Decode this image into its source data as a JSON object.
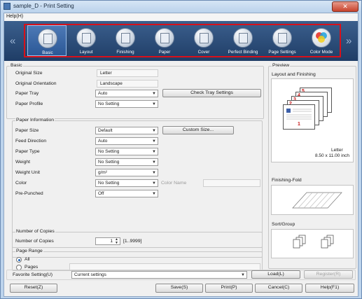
{
  "window": {
    "title": "sample_D - Print Setting"
  },
  "menu": {
    "help": "Help(H)"
  },
  "tabs": [
    {
      "label": "Basic",
      "icon": "basic-icon"
    },
    {
      "label": "Layout",
      "icon": "layout-icon"
    },
    {
      "label": "Finishing",
      "icon": "finishing-icon"
    },
    {
      "label": "Paper",
      "icon": "paper-icon"
    },
    {
      "label": "Cover",
      "icon": "cover-icon"
    },
    {
      "label": "Perfect Binding",
      "icon": "perfect-binding-icon"
    },
    {
      "label": "Page Settings",
      "icon": "page-settings-icon"
    },
    {
      "label": "Color Mode",
      "icon": "color-mode-icon"
    }
  ],
  "basic": {
    "group_title": "Basic",
    "original_size_label": "Original Size",
    "original_size_value": "Letter",
    "original_orientation_label": "Original Orientation",
    "original_orientation_value": "Landscape",
    "paper_tray_label": "Paper Tray",
    "paper_tray_value": "Auto",
    "check_tray_button": "Check Tray Settings",
    "paper_profile_label": "Paper Profile",
    "paper_profile_value": "No Setting"
  },
  "paper_info": {
    "group_title": "Paper Information",
    "paper_size_label": "Paper Size",
    "paper_size_value": "Default",
    "custom_size_button": "Custom Size...",
    "feed_direction_label": "Feed Direction",
    "feed_direction_value": "Auto",
    "paper_type_label": "Paper Type",
    "paper_type_value": "No Setting",
    "weight_label": "Weight",
    "weight_value": "No Setting",
    "weight_unit_label": "Weight Unit",
    "weight_unit_value": "g/m²",
    "color_label": "Color",
    "color_value": "No Setting",
    "color_name_label": "Color Name",
    "pre_punched_label": "Pre-Punched",
    "pre_punched_value": "Off"
  },
  "copies": {
    "group_title": "Number of Copies",
    "label": "Number of Copies",
    "value": "1",
    "range": "[1..9999]"
  },
  "page_range": {
    "group_title": "Page Range",
    "all_label": "All",
    "pages_label": "Pages",
    "selected": "All"
  },
  "preview": {
    "title": "Preview",
    "layout_finishing_label": "Layout and Finishing",
    "paper_size_text": "Letter",
    "paper_dims_text": "8.50 x 11.00 inch",
    "finishing_fold_label": "Finishing-Fold",
    "sort_group_label": "Sort/Group",
    "page_numbers": [
      "5",
      "4",
      "3",
      "2",
      "1"
    ]
  },
  "footer": {
    "favorite_label": "Favorite Setting(U)",
    "favorite_value": "Current settings",
    "load_button": "Load(L)",
    "register_button": "Register(R)",
    "reset_button": "Reset(Z)",
    "save_button": "Save(S)",
    "print_button": "Print(P)",
    "cancel_button": "Cancel(C)",
    "help_button": "Help(F1)"
  },
  "colors": {
    "tab_bar": "#27486f",
    "highlight_frame": "#d8101a",
    "page_number": "#c81818"
  }
}
